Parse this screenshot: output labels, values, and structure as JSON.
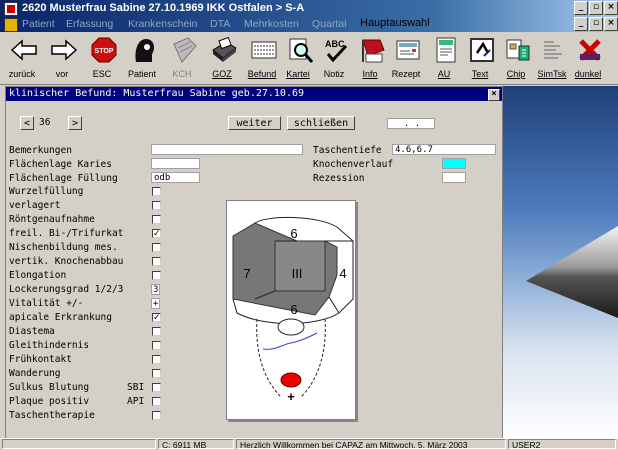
{
  "window": {
    "title": "2620 Musterfrau Sabine 27.10.1969  IKK Ostfalen > S-A"
  },
  "menu": [
    {
      "label": "Patient"
    },
    {
      "label": "Erfassung"
    },
    {
      "label": "Krankenschein"
    },
    {
      "label": "DTA"
    },
    {
      "label": "Mehrkosten"
    },
    {
      "label": "Quartal"
    },
    {
      "label": "Hauptauswahl"
    }
  ],
  "toolbar": [
    {
      "label": "zurück",
      "icon": "arrow-left-icon"
    },
    {
      "label": "vor",
      "icon": "arrow-right-icon"
    },
    {
      "label": "ESC",
      "icon": "stop-sign-icon"
    },
    {
      "label": "Patient",
      "icon": "patient-head-icon"
    },
    {
      "label": "KCH",
      "icon": "notebook-icon"
    },
    {
      "label": "GOZ",
      "icon": "printer-icon"
    },
    {
      "label": "Befund",
      "icon": "tooth-chart-icon"
    },
    {
      "label": "Kartei",
      "icon": "magnifier-icon"
    },
    {
      "label": "Notiz",
      "icon": "spellcheck-icon"
    },
    {
      "label": "Info",
      "icon": "flag-icon"
    },
    {
      "label": "Rezept",
      "icon": "prescription-icon"
    },
    {
      "label": "AU",
      "icon": "au-form-icon"
    },
    {
      "label": "Text",
      "icon": "text-doc-icon"
    },
    {
      "label": "Chip",
      "icon": "chip-card-icon"
    },
    {
      "label": "SimTsk",
      "icon": "sim-task-icon"
    },
    {
      "label": "dunkel",
      "icon": "dark-x-icon"
    }
  ],
  "dialog": {
    "title": "klinischer Befund: Musterfrau Sabine geb.27.10.69",
    "nav": {
      "prev": "<",
      "number": "36",
      "next": ">"
    },
    "buttons": {
      "weiter": "weiter",
      "schliessen": "schließen"
    },
    "date_field": ". .",
    "fields": {
      "bemerkungen": {
        "label": "Bemerkungen",
        "value": ""
      },
      "flaechenlage_karies": {
        "label": "Flächenlage Karies",
        "value": ""
      },
      "flaechenlage_fuellung": {
        "label": "Flächenlage Füllung",
        "value": "odb"
      },
      "taschentiefe": {
        "label": "Taschentiefe",
        "value": "4.6,6.7"
      },
      "knochenverlauf": {
        "label": "Knochenverlauf",
        "color": "#00ffff"
      },
      "rezession": {
        "label": "Rezession",
        "value": ""
      },
      "lockerungsgrad": {
        "label": "Lockerungsgrad 1/2/3",
        "value": "3"
      },
      "vitalitaet": {
        "label": "Vitalität +/-",
        "value": "+"
      }
    },
    "checkboxes": [
      {
        "label": "Wurzelfüllung",
        "checked": false
      },
      {
        "label": "verlagert",
        "checked": false
      },
      {
        "label": "Röntgenaufnahme",
        "checked": false
      },
      {
        "label": "freil. Bi-/Trifurkat",
        "checked": true
      },
      {
        "label": "Nischenbildung mes.",
        "checked": false
      },
      {
        "label": "vertik. Knochenabbau",
        "checked": false
      },
      {
        "label": "Elongation",
        "checked": false
      }
    ],
    "checkboxes2": [
      {
        "label": "apicale Erkrankung",
        "checked": true
      },
      {
        "label": "Diastema",
        "checked": false
      },
      {
        "label": "Gleithindernis",
        "checked": false
      },
      {
        "label": "Frühkontakt",
        "checked": false
      },
      {
        "label": "Wanderung",
        "checked": false
      },
      {
        "label": "Sulkus Blutung",
        "suffix": "SBI",
        "checked": false
      },
      {
        "label": "Plaque positiv",
        "suffix": "API",
        "checked": false
      },
      {
        "label": "Taschentherapie",
        "checked": false
      }
    ],
    "tooth": {
      "top": "6",
      "left": "7",
      "center": "III",
      "right": "4",
      "bottom": "6",
      "root_symbol": "+",
      "colors": {
        "fill": "#777777",
        "apex": "#ee0000",
        "line": "#3344cc"
      }
    }
  },
  "status": {
    "memory": "C: 6911 MB",
    "message": "Herzlich Willkommen bei CAPAZ am  Mittwoch, 5. März 2003",
    "user": "USER2"
  }
}
